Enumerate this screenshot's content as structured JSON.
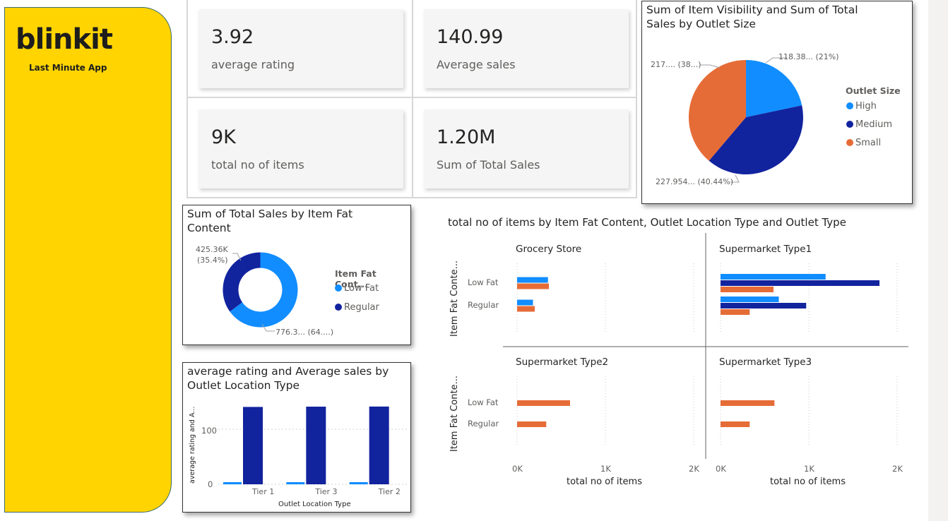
{
  "brand": {
    "name": "blinkit",
    "tagline": "Last Minute App"
  },
  "kpis": [
    {
      "value": "3.92",
      "label": "average rating"
    },
    {
      "value": "140.99",
      "label": "Average sales"
    },
    {
      "value": "9K",
      "label": "total no of items"
    },
    {
      "value": "1.20M",
      "label": "Sum of Total Sales"
    }
  ],
  "colors": {
    "high": "#118dff",
    "medium": "#12239e",
    "small": "#e66c37",
    "sidebar": "#ffd400"
  },
  "pie_outlet": {
    "title_line1": "Sum of Item Visibility and Sum of Total",
    "title_line2": "Sales by Outlet Size",
    "legend_title": "Outlet Size",
    "data_labels": {
      "high": "118.38... (21%)",
      "small": "217.... (38...)",
      "medium": "227.954... (40.44%)"
    }
  },
  "donut_fat": {
    "title_line1": "Sum of Total Sales by Item Fat",
    "title_line2": "Content",
    "legend_title": "Item Fat Cont...",
    "labels": {
      "regular_value": "425.36K",
      "regular_pct": "(35.4%)",
      "lowfat": "776.3... (64....)"
    }
  },
  "bar_location": {
    "title_line1": "average rating and Average sales by",
    "title_line2": "Outlet Location Type",
    "ylabel": "average rating and A...",
    "xlabel": "Outlet Location Type",
    "ytick_100": "100",
    "ytick_0": "0"
  },
  "facet": {
    "title": "total no of items by Item Fat Content, Outlet Location Type and Outlet Type",
    "row_label": "Item Fat Conte...",
    "xlabel": "total no of items",
    "ticks": [
      "0K",
      "1K",
      "2K"
    ],
    "panel_titles": [
      "Grocery Store",
      "Supermarket Type1",
      "Supermarket Type2",
      "Supermarket Type3"
    ]
  },
  "chart_data": [
    {
      "type": "pie",
      "title": "Sum of Item Visibility and Sum of Total Sales by Outlet Size",
      "legend": "right",
      "categories": [
        "High",
        "Medium",
        "Small"
      ],
      "values": [
        21,
        40.44,
        38.56
      ],
      "data_labels": [
        "118.38... (21%)",
        "227.954... (40.44%)",
        "217.... (38...)"
      ]
    },
    {
      "type": "pie",
      "title": "Sum of Total Sales by Item Fat Content",
      "legend": "right",
      "categories": [
        "Low Fat",
        "Regular"
      ],
      "values": [
        64.6,
        35.4
      ],
      "data_labels": [
        "776.3... (64....)",
        "425.36K (35.4%)"
      ]
    },
    {
      "type": "bar",
      "title": "average rating and Average sales by Outlet Location Type",
      "xlabel": "Outlet Location Type",
      "ylabel": "average rating and A...",
      "categories": [
        "Tier 1",
        "Tier 3",
        "Tier 2"
      ],
      "series": [
        {
          "values": [
            3.9,
            3.9,
            3.9
          ]
        },
        {
          "values": [
            140.5,
            141.0,
            141.2
          ]
        }
      ],
      "ylim": [
        0,
        150
      ],
      "yticks": [
        0,
        100
      ]
    },
    {
      "type": "bar",
      "title": "total no of items by Item Fat Content, Outlet Location Type and Outlet Type",
      "orientation": "horizontal",
      "xlabel": "total no of items",
      "xlim": [
        0,
        2000
      ],
      "categories": [
        "Low Fat",
        "Regular"
      ],
      "series_order": [
        "Tier 1",
        "Tier 3",
        "Tier 2"
      ],
      "panels": [
        {
          "name": "Grocery Store",
          "rows": [
            [
              350,
              0,
              360
            ],
            [
              180,
              0,
              200
            ]
          ]
        },
        {
          "name": "Supermarket Type1",
          "rows": [
            [
              1190,
              1800,
              600
            ],
            [
              660,
              970,
              330
            ]
          ]
        },
        {
          "name": "Supermarket Type2",
          "rows": [
            [
              0,
              0,
              600
            ],
            [
              0,
              0,
              330
            ]
          ]
        },
        {
          "name": "Supermarket Type3",
          "rows": [
            [
              0,
              0,
              610
            ],
            [
              0,
              0,
              330
            ]
          ]
        }
      ]
    }
  ]
}
